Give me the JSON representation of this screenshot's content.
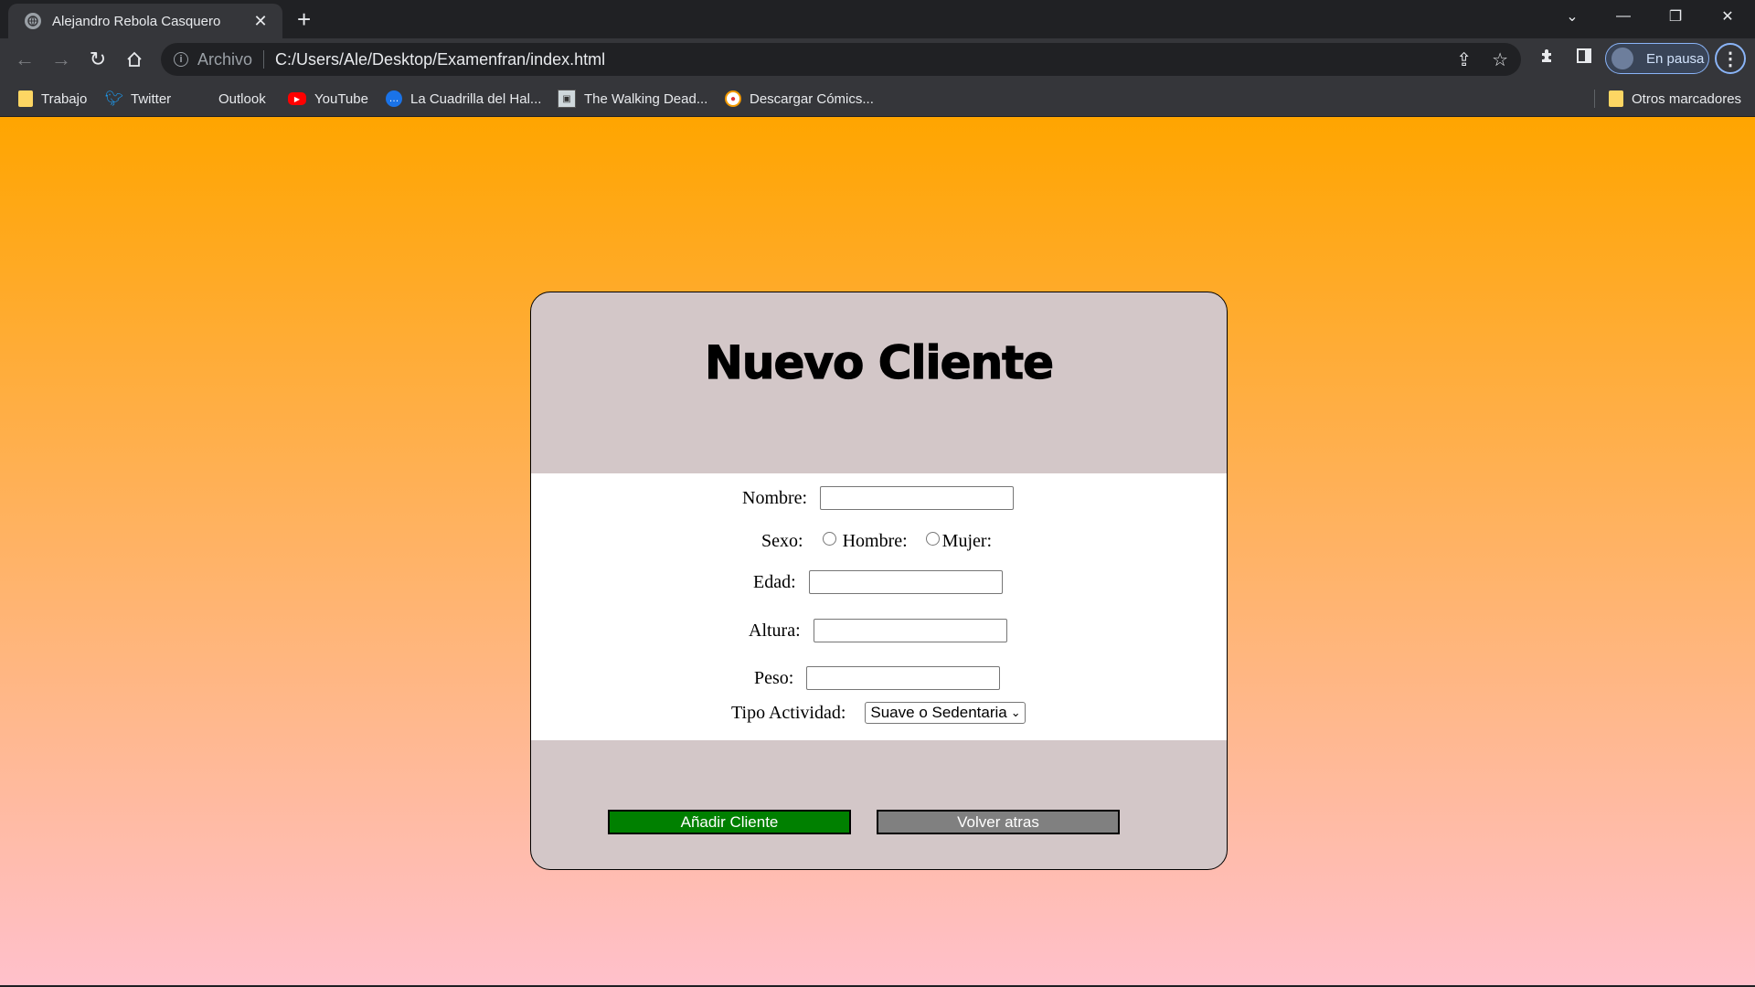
{
  "browser": {
    "tab_title": "Alejandro Rebola Casquero",
    "new_tab": "+",
    "address_scheme": "Archivo",
    "address_url": "C:/Users/Ale/Desktop/Examenfran/index.html",
    "profile_label": "En pausa",
    "bookmarks": [
      {
        "label": "Trabajo",
        "icon": "folder-icon"
      },
      {
        "label": "Twitter",
        "icon": "twitter-icon"
      },
      {
        "label": "Outlook",
        "icon": "outlook-icon"
      },
      {
        "label": "YouTube",
        "icon": "youtube-icon"
      },
      {
        "label": "La Cuadrilla del Hal...",
        "icon": "chat-icon"
      },
      {
        "label": "The Walking Dead...",
        "icon": "site-icon"
      },
      {
        "label": "Descargar Cómics...",
        "icon": "site-icon"
      }
    ],
    "other_bookmarks": "Otros marcadores"
  },
  "page": {
    "title": "Nuevo Cliente",
    "form": {
      "nombre_label": "Nombre:",
      "nombre_value": "",
      "sexo_label": "Sexo:",
      "sexo_options": [
        "Hombre:",
        "Mujer:"
      ],
      "edad_label": "Edad:",
      "edad_value": "",
      "altura_label": "Altura:",
      "altura_value": "",
      "peso_label": "Peso:",
      "peso_value": "",
      "actividad_label": "Tipo Actividad:",
      "actividad_selected": "Suave o Sedentaria"
    },
    "buttons": {
      "add": "Añadir Cliente",
      "back": "Volver atras"
    }
  },
  "colors": {
    "gradient_top": "#ffa500",
    "gradient_bottom": "#ffc0cb",
    "card_bg": "#d3c7c8",
    "add_button": "#008000",
    "back_button": "#808080"
  }
}
